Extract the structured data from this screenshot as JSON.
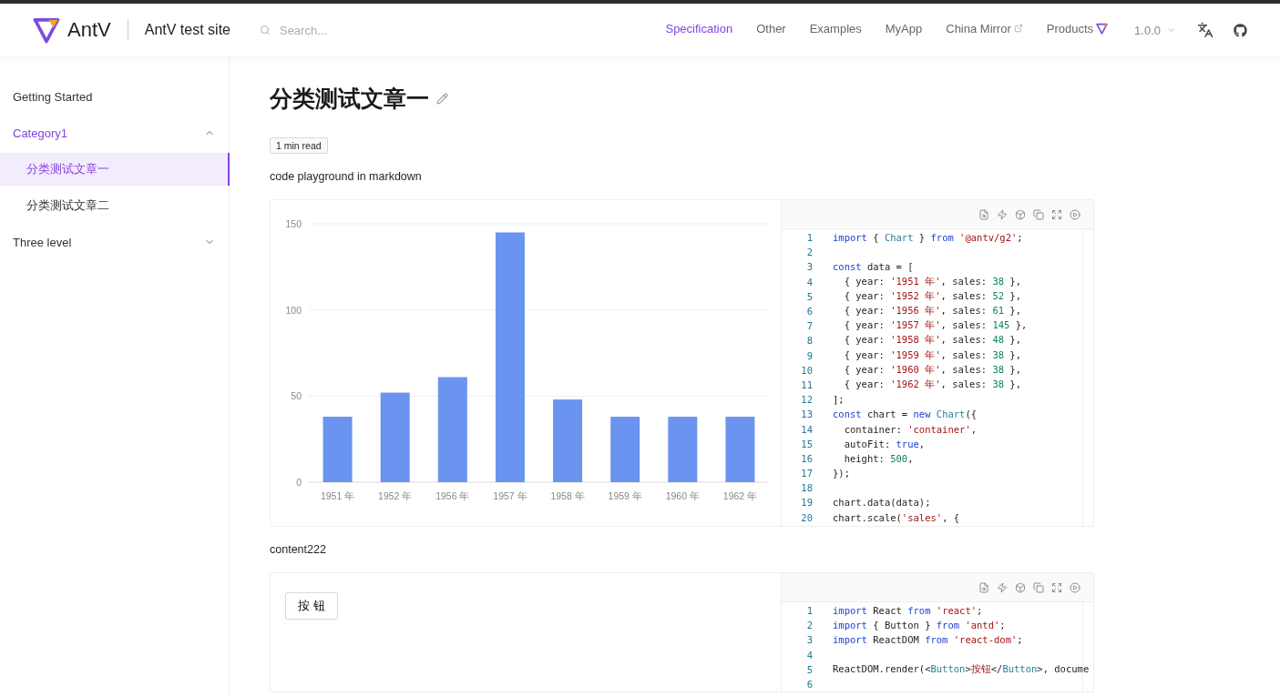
{
  "header": {
    "logo_text": "AntV",
    "site_title": "AntV test site",
    "search": {
      "placeholder": "Search..."
    },
    "nav": [
      {
        "label": "Specification",
        "selected": true,
        "kind": "plain"
      },
      {
        "label": "Other",
        "selected": false,
        "kind": "plain"
      },
      {
        "label": "Examples",
        "selected": false,
        "kind": "plain"
      },
      {
        "label": "MyApp",
        "selected": false,
        "kind": "plain"
      },
      {
        "label": "China Mirror",
        "selected": false,
        "kind": "external"
      },
      {
        "label": "Products",
        "selected": false,
        "kind": "products"
      }
    ],
    "version": "1.0.0"
  },
  "sidebar": {
    "items": [
      {
        "label": "Getting Started",
        "selected": false
      },
      {
        "label": "Category1",
        "selected": false,
        "expanded": true,
        "children": [
          {
            "label": "分类测试文章一",
            "selected": true
          },
          {
            "label": "分类测试文章二",
            "selected": false
          }
        ]
      },
      {
        "label": "Three level",
        "selected": false,
        "expanded": false
      }
    ]
  },
  "article": {
    "title": "分类测试文章一",
    "read_time": "1 min read",
    "blocks": [
      {
        "kind": "text",
        "text": "code playground in markdown"
      },
      {
        "kind": "playground",
        "preview": {
          "kind": "chart",
          "chart_data": {
            "type": "bar",
            "categories": [
              "1951 年",
              "1952 年",
              "1956 年",
              "1957 年",
              "1958 年",
              "1959 年",
              "1960 年",
              "1962 年"
            ],
            "series": [
              {
                "color": "#6b94f0",
                "values": [
                  38,
                  52,
                  61,
                  145,
                  48,
                  38,
                  38,
                  38
                ]
              }
            ],
            "ylim": [
              0,
              150
            ],
            "yticks": [
              0,
              50,
              100,
              150
            ]
          }
        },
        "code": [
          {
            "number": "1",
            "tokens": [
              {
                "kind": "kw",
                "text": "import"
              },
              {
                "kind": "p",
                "text": " { "
              },
              {
                "kind": "ty",
                "text": "Chart"
              },
              {
                "kind": "p",
                "text": " } "
              },
              {
                "kind": "kw",
                "text": "from "
              },
              {
                "kind": "str",
                "text": "'@antv/g2'"
              },
              {
                "kind": "p",
                "text": ";"
              }
            ]
          },
          {
            "number": "2"
          },
          {
            "number": "3",
            "tokens": [
              {
                "kind": "kw",
                "text": "const"
              },
              {
                "kind": "p",
                "text": " data = ["
              }
            ]
          },
          {
            "number": "4",
            "tokens": [
              {
                "kind": "p",
                "text": "  { year: "
              },
              {
                "kind": "str",
                "text": "'1951 年'"
              },
              {
                "kind": "p",
                "text": ", sales: "
              },
              {
                "kind": "num",
                "text": "38"
              },
              {
                "kind": "p",
                "text": " },"
              }
            ]
          },
          {
            "number": "5",
            "tokens": [
              {
                "kind": "p",
                "text": "  { year: "
              },
              {
                "kind": "str",
                "text": "'1952 年'"
              },
              {
                "kind": "p",
                "text": ", sales: "
              },
              {
                "kind": "num",
                "text": "52"
              },
              {
                "kind": "p",
                "text": " },"
              }
            ]
          },
          {
            "number": "6",
            "tokens": [
              {
                "kind": "p",
                "text": "  { year: "
              },
              {
                "kind": "str",
                "text": "'1956 年'"
              },
              {
                "kind": "p",
                "text": ", sales: "
              },
              {
                "kind": "num",
                "text": "61"
              },
              {
                "kind": "p",
                "text": " },"
              }
            ]
          },
          {
            "number": "7",
            "tokens": [
              {
                "kind": "p",
                "text": "  { year: "
              },
              {
                "kind": "str",
                "text": "'1957 年'"
              },
              {
                "kind": "p",
                "text": ", sales: "
              },
              {
                "kind": "num",
                "text": "145"
              },
              {
                "kind": "p",
                "text": " },"
              }
            ]
          },
          {
            "number": "8",
            "tokens": [
              {
                "kind": "p",
                "text": "  { year: "
              },
              {
                "kind": "str",
                "text": "'1958 年'"
              },
              {
                "kind": "p",
                "text": ", sales: "
              },
              {
                "kind": "num",
                "text": "48"
              },
              {
                "kind": "p",
                "text": " },"
              }
            ]
          },
          {
            "number": "9",
            "tokens": [
              {
                "kind": "p",
                "text": "  { year: "
              },
              {
                "kind": "str",
                "text": "'1959 年'"
              },
              {
                "kind": "p",
                "text": ", sales: "
              },
              {
                "kind": "num",
                "text": "38"
              },
              {
                "kind": "p",
                "text": " },"
              }
            ]
          },
          {
            "number": "10",
            "tokens": [
              {
                "kind": "p",
                "text": "  { year: "
              },
              {
                "kind": "str",
                "text": "'1960 年'"
              },
              {
                "kind": "p",
                "text": ", sales: "
              },
              {
                "kind": "num",
                "text": "38"
              },
              {
                "kind": "p",
                "text": " },"
              }
            ]
          },
          {
            "number": "11",
            "tokens": [
              {
                "kind": "p",
                "text": "  { year: "
              },
              {
                "kind": "str",
                "text": "'1962 年'"
              },
              {
                "kind": "p",
                "text": ", sales: "
              },
              {
                "kind": "num",
                "text": "38"
              },
              {
                "kind": "p",
                "text": " },"
              }
            ]
          },
          {
            "number": "12",
            "tokens": [
              {
                "kind": "p",
                "text": "];"
              }
            ]
          },
          {
            "number": "13",
            "tokens": [
              {
                "kind": "kw",
                "text": "const"
              },
              {
                "kind": "p",
                "text": " chart = "
              },
              {
                "kind": "kw",
                "text": "new "
              },
              {
                "kind": "ty",
                "text": "Chart"
              },
              {
                "kind": "p",
                "text": "({"
              }
            ]
          },
          {
            "number": "14",
            "tokens": [
              {
                "kind": "p",
                "text": "  container: "
              },
              {
                "kind": "str",
                "text": "'container'"
              },
              {
                "kind": "p",
                "text": ","
              }
            ]
          },
          {
            "number": "15",
            "tokens": [
              {
                "kind": "p",
                "text": "  autoFit: "
              },
              {
                "kind": "kw",
                "text": "true"
              },
              {
                "kind": "p",
                "text": ","
              }
            ]
          },
          {
            "number": "16",
            "tokens": [
              {
                "kind": "p",
                "text": "  height: "
              },
              {
                "kind": "num",
                "text": "500"
              },
              {
                "kind": "p",
                "text": ","
              }
            ]
          },
          {
            "number": "17",
            "tokens": [
              {
                "kind": "p",
                "text": "});"
              }
            ]
          },
          {
            "number": "18"
          },
          {
            "number": "19",
            "tokens": [
              {
                "kind": "p",
                "text": "chart.data(data);"
              }
            ]
          },
          {
            "number": "20",
            "tokens": [
              {
                "kind": "p",
                "text": "chart.scale("
              },
              {
                "kind": "str",
                "text": "'sales'"
              },
              {
                "kind": "p",
                "text": ", {"
              }
            ]
          }
        ]
      },
      {
        "kind": "text",
        "text": "content222"
      },
      {
        "kind": "playground",
        "preview": {
          "kind": "button",
          "label": "按 钮"
        },
        "code": [
          {
            "number": "1",
            "tokens": [
              {
                "kind": "kw",
                "text": "import"
              },
              {
                "kind": "p",
                "text": " React "
              },
              {
                "kind": "kw",
                "text": "from "
              },
              {
                "kind": "str",
                "text": "'react'"
              },
              {
                "kind": "p",
                "text": ";"
              }
            ]
          },
          {
            "number": "2",
            "tokens": [
              {
                "kind": "kw",
                "text": "import"
              },
              {
                "kind": "p",
                "text": " { Button } "
              },
              {
                "kind": "kw",
                "text": "from "
              },
              {
                "kind": "str",
                "text": "'antd'"
              },
              {
                "kind": "p",
                "text": ";"
              }
            ]
          },
          {
            "number": "3",
            "tokens": [
              {
                "kind": "kw",
                "text": "import"
              },
              {
                "kind": "p",
                "text": " ReactDOM "
              },
              {
                "kind": "kw",
                "text": "from "
              },
              {
                "kind": "str",
                "text": "'react-dom'"
              },
              {
                "kind": "p",
                "text": ";"
              }
            ]
          },
          {
            "number": "4"
          },
          {
            "number": "5",
            "tokens": [
              {
                "kind": "p",
                "text": "ReactDOM.render(<"
              },
              {
                "kind": "ty",
                "text": "Button"
              },
              {
                "kind": "p",
                "text": ">"
              },
              {
                "kind": "str",
                "text": "按钮"
              },
              {
                "kind": "p",
                "text": "</"
              },
              {
                "kind": "ty",
                "text": "Button"
              },
              {
                "kind": "p",
                "text": ">, docume"
              }
            ]
          },
          {
            "number": "6"
          }
        ]
      }
    ]
  }
}
